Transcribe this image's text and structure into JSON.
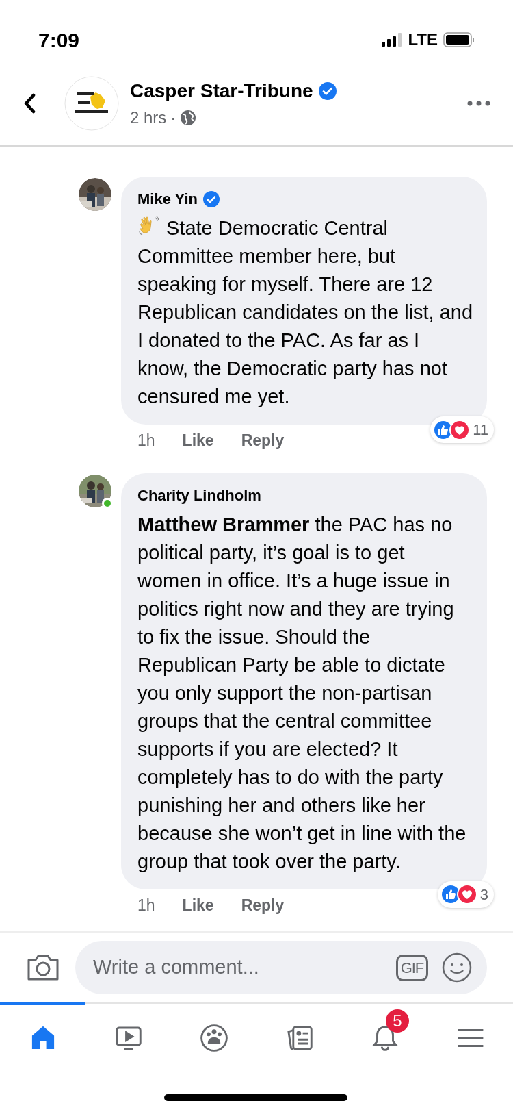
{
  "status_bar": {
    "time": "7:09",
    "network": "LTE"
  },
  "header": {
    "page_name": "Casper Star-Tribune",
    "verified": true,
    "time": "2 hrs",
    "separator": "·"
  },
  "comments": [
    {
      "author": "Mike Yin",
      "verified": true,
      "online": false,
      "emoji": true,
      "text": "State Democratic Central Committee member here, but speaking for myself. There are 12 Republican candidates on the list, and I donated to the PAC. As far as I know, the Democratic party has not censured me yet.",
      "time": "1h",
      "like": "Like",
      "reply": "Reply",
      "reaction_count": "11"
    },
    {
      "author": "Charity Lindholm",
      "verified": false,
      "online": true,
      "emoji": false,
      "text": "**Matthew Brammer** the PAC has no political party, it’s goal is to get women in office. It’s a huge issue in politics right now and they are trying to fix the issue. Should the Republican Party be able to dictate you only support the non-partisan groups that the central committee supports if you are elected? It completely has to do with the party punishing her and others like her because she won’t get in line with the group that took over the party.",
      "time": "1h",
      "like": "Like",
      "reply": "Reply",
      "reaction_count": "3"
    }
  ],
  "composer": {
    "placeholder": "Write a comment...",
    "gif": "GIF"
  },
  "nav": [
    {
      "selected": true
    },
    {
      "selected": false
    },
    {
      "selected": false
    },
    {
      "selected": false
    },
    {
      "selected": false,
      "badge": "5"
    },
    {
      "selected": false
    }
  ]
}
